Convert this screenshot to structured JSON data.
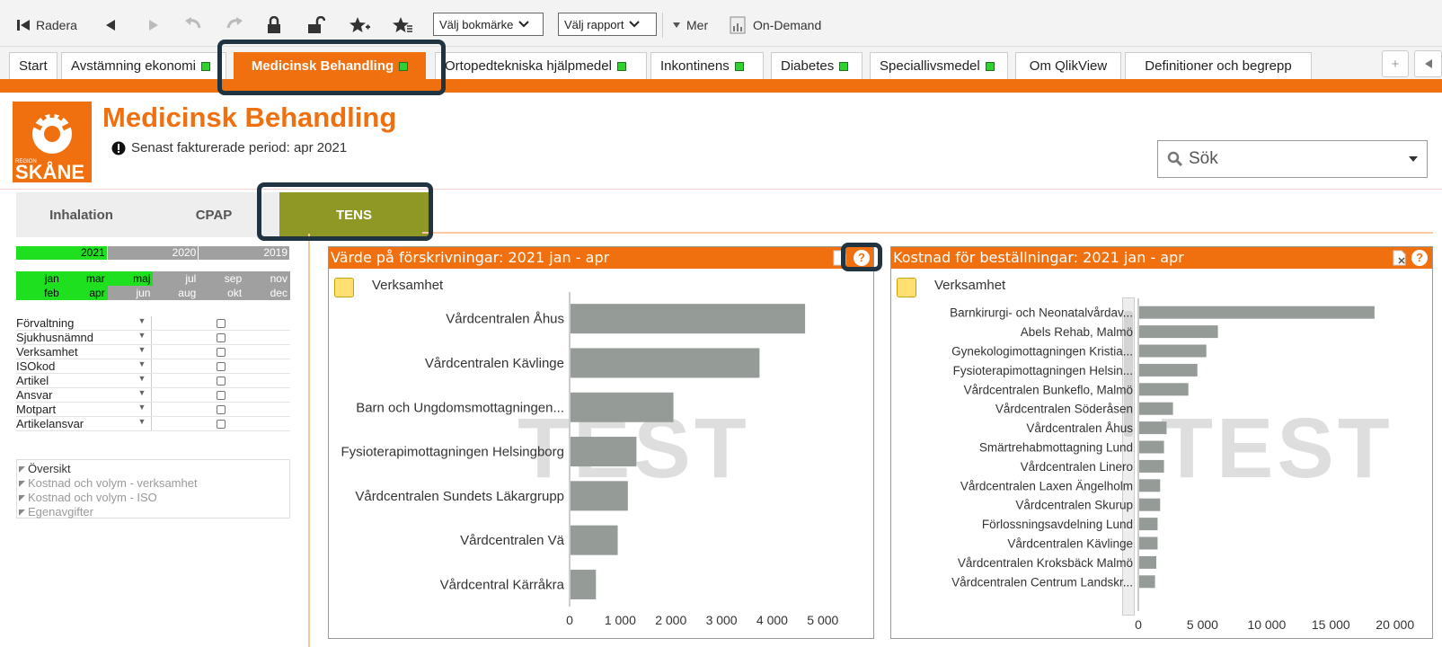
{
  "toolbar": {
    "clear_label": "Radera",
    "bookmark_select": "Välj bokmärke",
    "report_select": "Välj rapport",
    "more_label": "Mer",
    "ondemand_label": "On-Demand"
  },
  "tabs": [
    {
      "label": "Start",
      "status": false
    },
    {
      "label": "Avstämning ekonomi",
      "status": true
    },
    {
      "label": "Medicinsk Behandling",
      "status": true,
      "active": true
    },
    {
      "label": "Ortopedtekniska hjälpmedel",
      "status": true
    },
    {
      "label": "Inkontinens",
      "status": true
    },
    {
      "label": "Diabetes",
      "status": true
    },
    {
      "label": "Speciallivsmedel",
      "status": true
    },
    {
      "label": "Om QlikView",
      "status": false
    },
    {
      "label": "Definitioner och begrepp",
      "status": false
    }
  ],
  "header": {
    "logo_text": "SKÅNE",
    "logo_small": "REGION",
    "title": "Medicinsk Behandling",
    "period": "Senast fakturerade period: apr 2021",
    "search_placeholder": "Sök"
  },
  "subtabs": [
    "Inhalation",
    "CPAP",
    "TENS"
  ],
  "selected_subtab": "TENS",
  "years": [
    {
      "label": "2021",
      "selected": true
    },
    {
      "label": "2020",
      "selected": false
    },
    {
      "label": "2019",
      "selected": false
    }
  ],
  "months": [
    {
      "label": "jan",
      "selected": true
    },
    {
      "label": "mar",
      "selected": true
    },
    {
      "label": "maj",
      "selected": true
    },
    {
      "label": "jul",
      "selected": false
    },
    {
      "label": "sep",
      "selected": false
    },
    {
      "label": "nov",
      "selected": false
    },
    {
      "label": "feb",
      "selected": true
    },
    {
      "label": "apr",
      "selected": true
    },
    {
      "label": "jun",
      "selected": false
    },
    {
      "label": "aug",
      "selected": false
    },
    {
      "label": "okt",
      "selected": false
    },
    {
      "label": "dec",
      "selected": false
    }
  ],
  "filters": [
    "Förvaltning",
    "Sjukhusnämnd",
    "Verksamhet",
    "ISOkod",
    "Artikel",
    "Ansvar",
    "Motpart",
    "Artikelansvar"
  ],
  "nav_links": [
    "Översikt",
    "Kostnad och volym - verksamhet",
    "Kostnad och volym - ISO",
    "Egenavgifter"
  ],
  "panel_left": {
    "title": "Värde på förskrivningar: 2021 jan - apr",
    "dimension": "Verksamhet",
    "watermark": "TEST"
  },
  "panel_right": {
    "title": "Kostnad för beställningar: 2021 jan - apr",
    "dimension": "Verksamhet",
    "watermark": "TEST"
  },
  "chart_data": [
    {
      "type": "bar",
      "orientation": "horizontal",
      "title": "Värde på förskrivningar: 2021 jan - apr",
      "categories": [
        "Vårdcentralen Åhus",
        "Vårdcentralen Kävlinge",
        "Barn och Ungdomsmottagningen...",
        "Fysioterapimottagningen Helsingborg",
        "Vårdcentralen Sundets Läkargrupp",
        "Vårdcentralen Vä",
        "Vårdcentral Kärråkra"
      ],
      "values": [
        4650,
        3750,
        2050,
        1320,
        1150,
        950,
        520
      ],
      "xlim": [
        0,
        5500
      ],
      "ticks": [
        "0",
        "1 000",
        "2 000",
        "3 000",
        "4 000",
        "5 000"
      ],
      "tick_values": [
        0,
        1000,
        2000,
        3000,
        4000,
        5000
      ],
      "color": "#959b96"
    },
    {
      "type": "bar",
      "orientation": "horizontal",
      "title": "Kostnad för beställningar: 2021 jan - apr",
      "categories": [
        "Barnkirurgi- och Neonatalvårdav...",
        "Abels Rehab, Malmö",
        "Gynekologimottagningen Kristia...",
        "Fysioterapimottagningen Helsin...",
        "Vårdcentralen Bunkeflo, Malmö",
        "Vårdcentralen Söderåsen",
        "Vårdcentralen Åhus",
        "Smärtrehabmottagning Lund",
        "Vårdcentralen Linero",
        "Vårdcentralen Laxen Ängelholm",
        "Vårdcentralen Skurup",
        "Förlossningsavdelning Lund",
        "Vårdcentralen Kävlinge",
        "Vårdcentralen Kroksbäck Malmö",
        "Vårdcentralen Centrum Landskr..."
      ],
      "values": [
        18400,
        6200,
        5300,
        4600,
        3900,
        2700,
        2200,
        2000,
        2000,
        1700,
        1700,
        1500,
        1500,
        1400,
        1300
      ],
      "xlim": [
        0,
        21000
      ],
      "ticks": [
        "0",
        "5 000",
        "10 000",
        "15 000",
        "20 000"
      ],
      "tick_values": [
        0,
        5000,
        10000,
        15000,
        20000
      ],
      "color": "#959b96"
    }
  ]
}
